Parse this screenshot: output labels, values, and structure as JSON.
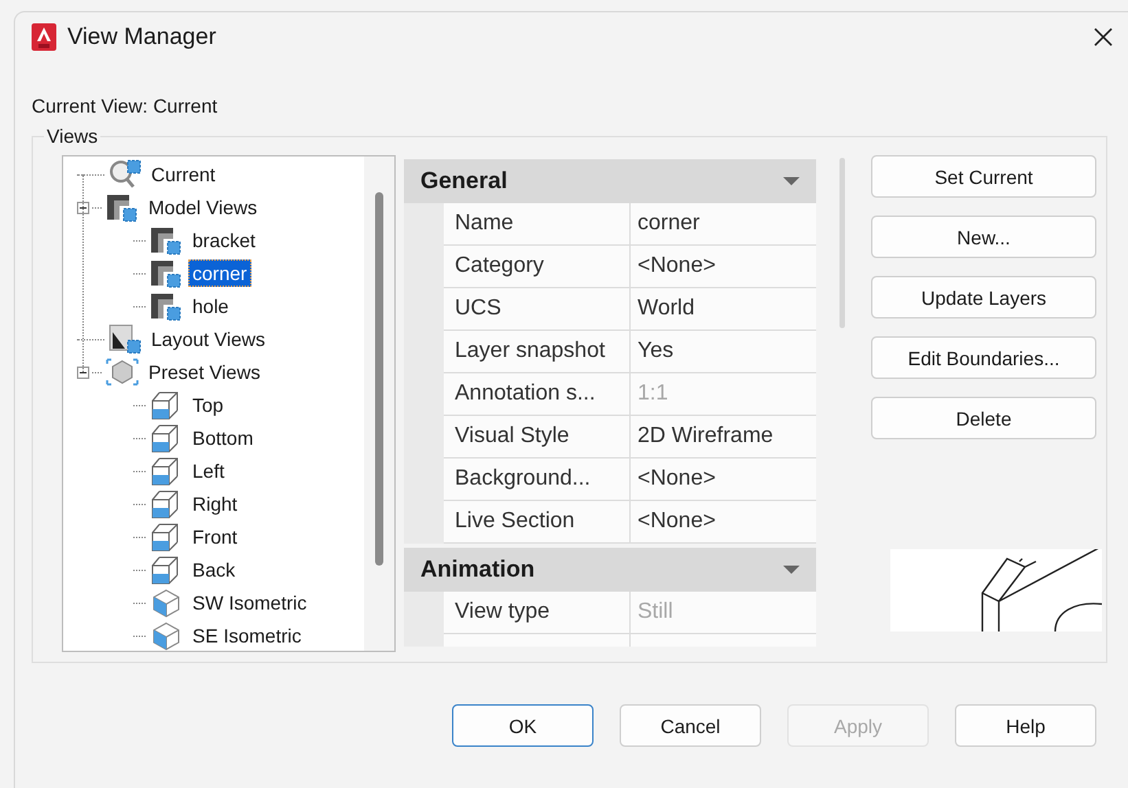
{
  "window": {
    "title": "View Manager"
  },
  "current_view": "Current View: Current",
  "views_group": {
    "label": "Views"
  },
  "tree": [
    {
      "label": "Current",
      "kind": "current",
      "selected": false
    },
    {
      "label": "Model Views",
      "kind": "model",
      "selected": false,
      "expanded": true,
      "children": [
        {
          "label": "bracket",
          "kind": "model",
          "selected": false
        },
        {
          "label": "corner",
          "kind": "model",
          "selected": true
        },
        {
          "label": "hole",
          "kind": "model",
          "selected": false
        }
      ]
    },
    {
      "label": "Layout Views",
      "kind": "layout",
      "selected": false
    },
    {
      "label": "Preset Views",
      "kind": "preset",
      "selected": false,
      "expanded": true,
      "children": [
        {
          "label": "Top",
          "kind": "cube",
          "selected": false
        },
        {
          "label": "Bottom",
          "kind": "cube",
          "selected": false
        },
        {
          "label": "Left",
          "kind": "cube",
          "selected": false
        },
        {
          "label": "Right",
          "kind": "cube",
          "selected": false
        },
        {
          "label": "Front",
          "kind": "cube",
          "selected": false
        },
        {
          "label": "Back",
          "kind": "cube",
          "selected": false
        },
        {
          "label": "SW Isometric",
          "kind": "iso",
          "selected": false
        },
        {
          "label": "SE Isometric",
          "kind": "iso",
          "selected": false
        }
      ]
    }
  ],
  "properties": [
    {
      "title": "General",
      "expanded": true,
      "rows": [
        {
          "label": "Name",
          "value": "corner",
          "disabled": false
        },
        {
          "label": "Category",
          "value": "<None>",
          "disabled": false
        },
        {
          "label": "UCS",
          "value": "World",
          "disabled": false
        },
        {
          "label": "Layer snapshot",
          "value": "Yes",
          "disabled": false
        },
        {
          "label": "Annotation s...",
          "value": "1:1",
          "disabled": true
        },
        {
          "label": "Visual Style",
          "value": "2D Wireframe",
          "disabled": false
        },
        {
          "label": "Background...",
          "value": "<None>",
          "disabled": false
        },
        {
          "label": "Live Section",
          "value": "<None>",
          "disabled": false
        }
      ]
    },
    {
      "title": "Animation",
      "expanded": true,
      "rows": [
        {
          "label": "View type",
          "value": "Still",
          "disabled": true
        }
      ]
    }
  ],
  "side_buttons": [
    {
      "label": "Set Current",
      "disabled": false
    },
    {
      "label": "New...",
      "disabled": false
    },
    {
      "label": "Update Layers",
      "disabled": false
    },
    {
      "label": "Edit Boundaries...",
      "disabled": false
    },
    {
      "label": "Delete",
      "disabled": false
    }
  ],
  "dialog_buttons": [
    {
      "label": "OK",
      "default": true,
      "disabled": false
    },
    {
      "label": "Cancel",
      "default": false,
      "disabled": false
    },
    {
      "label": "Apply",
      "default": false,
      "disabled": true
    },
    {
      "label": "Help",
      "default": false,
      "disabled": false
    }
  ]
}
